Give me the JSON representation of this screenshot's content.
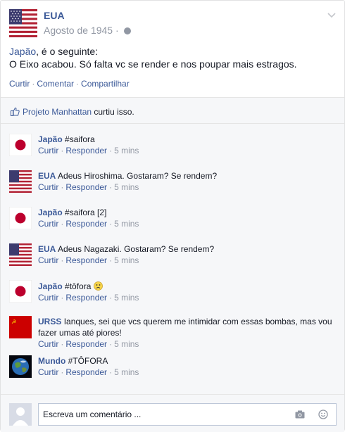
{
  "post": {
    "author": "EUA",
    "date": "Agosto de 1945",
    "dot": "·",
    "mention": "Japão",
    "line1_rest": ", é o seguinte:",
    "line2": "O Eixo acabou. Só falta vc se render e nos poupar mais estragos.",
    "actions": {
      "like": "Curtir",
      "comment": "Comentar",
      "share": "Compartilhar",
      "sep": "·"
    }
  },
  "likes": {
    "page": "Projeto Manhattan",
    "text": "curtiu isso."
  },
  "comment_actions": {
    "like": "Curtir",
    "reply": "Responder",
    "sep": "·"
  },
  "comments": [
    {
      "flag": "japan",
      "name": "Japão",
      "text": "#saifora",
      "time": "5 mins"
    },
    {
      "flag": "usa",
      "name": "EUA",
      "text": "Adeus Hiroshima. Gostaram? Se rendem?",
      "time": "5 mins"
    },
    {
      "flag": "japan",
      "name": "Japão",
      "text": "#saifora [2]",
      "time": "5 mins"
    },
    {
      "flag": "usa",
      "name": "EUA",
      "text": "Adeus Nagazaki. Gostaram? Se rendem?",
      "time": "5 mins"
    },
    {
      "flag": "japan",
      "name": "Japão",
      "text": "#tôfora",
      "emoji": "sad-face",
      "time": "5 mins"
    },
    {
      "flag": "ussr",
      "name": "URSS",
      "text": "Ianques, sei que vcs querem me intimidar com essas bombas, mas vou fazer umas até piores!",
      "time": "5 mins"
    },
    {
      "flag": "earth",
      "name": "Mundo",
      "text": "#TÔFORA",
      "time": "5 mins"
    }
  ],
  "compose": {
    "placeholder": "Escreva um comentário ..."
  },
  "colors": {
    "link": "#3b5998",
    "muted": "#9197a3",
    "japan_red": "#bc002d",
    "ussr_red": "#cc0000"
  }
}
